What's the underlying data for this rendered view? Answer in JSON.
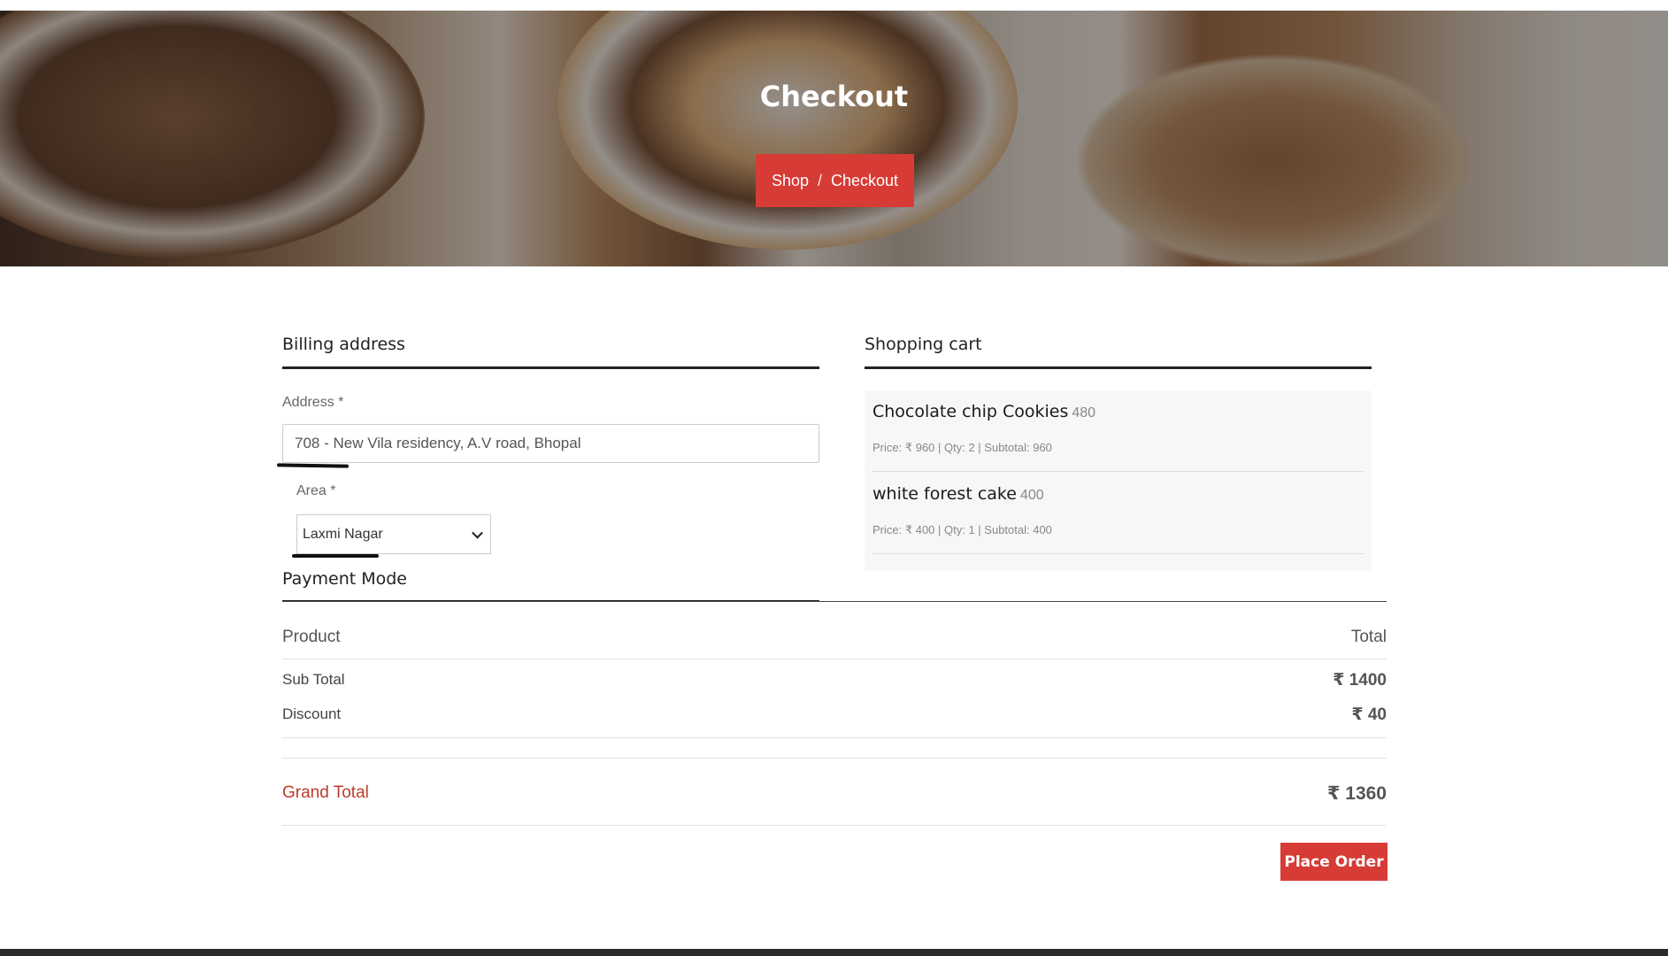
{
  "hero": {
    "title": "Checkout",
    "breadcrumb": [
      "Shop",
      "/",
      "Checkout"
    ]
  },
  "billing": {
    "heading": "Billing address",
    "address_label": "Address *",
    "address_value": "708 - New Vila residency, A.V road, Bhopal",
    "area_label": "Area *",
    "area_value": "Laxmi Nagar"
  },
  "cart": {
    "heading": "Shopping cart",
    "items": [
      {
        "name": "Chocolate chip Cookies",
        "price": "480",
        "meta": "Price: ₹ 960   |  Qty: 2  |    Subtotal: 960"
      },
      {
        "name": "white forest cake",
        "price": "400",
        "meta": "Price: ₹ 400   |  Qty: 1  |    Subtotal: 400"
      }
    ]
  },
  "payment": {
    "heading": "Payment Mode",
    "product_header": "Product",
    "total_header": "Total",
    "subtotal_label": "Sub Total",
    "subtotal_value": "₹ 1400",
    "discount_label": "Discount",
    "discount_value": "₹ 40",
    "grand_label": "Grand Total",
    "grand_value": "₹ 1360",
    "place_order": "Place Order"
  },
  "colors": {
    "accent": "#d73b35",
    "grand_total": "#c0392b"
  }
}
